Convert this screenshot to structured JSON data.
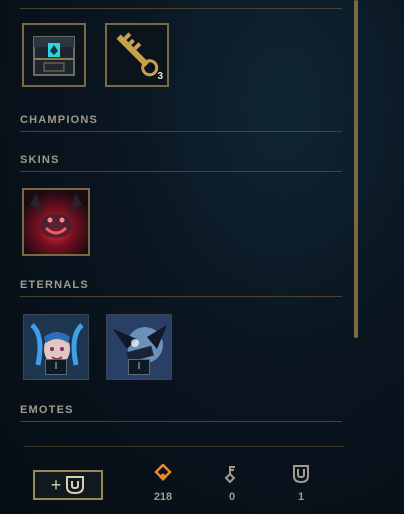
{
  "sections": {
    "champions": "CHAMPIONS",
    "skins": "SKINS",
    "eternals": "ETERNALS",
    "emotes": "EMOTES"
  },
  "top_items": [
    {
      "name": "hextech-chest",
      "count": ""
    },
    {
      "name": "hextech-key",
      "count": "3"
    }
  ],
  "eternals": [
    {
      "name": "jinx-eternal-1",
      "level": "I"
    },
    {
      "name": "jinx-eternal-2",
      "level": "I"
    }
  ],
  "footer": {
    "add_button_plus": "+",
    "currencies": [
      {
        "icon": "orange-essence-icon",
        "value": "218"
      },
      {
        "icon": "key-fragment-icon",
        "value": "0"
      },
      {
        "icon": "chest-icon",
        "value": "1"
      }
    ]
  },
  "colors": {
    "gold": "#c8aa6e",
    "border_gold": "#7a6a43",
    "orange_essence": "#e5892a"
  }
}
